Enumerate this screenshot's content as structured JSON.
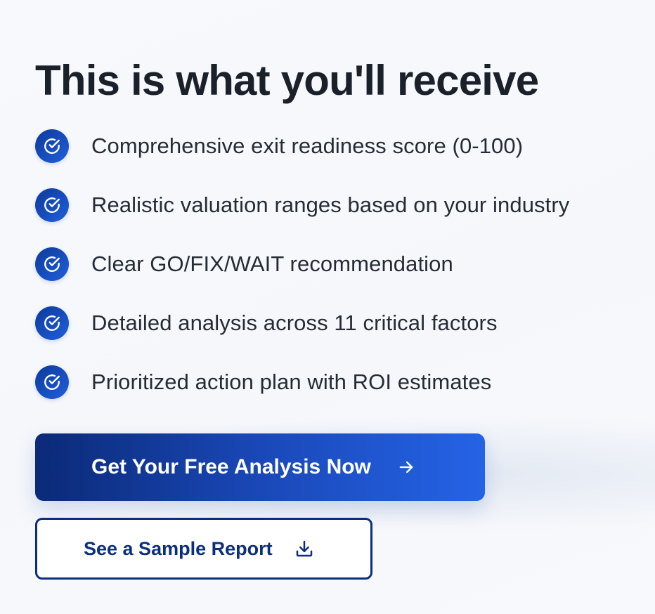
{
  "heading": "This is what you'll receive",
  "benefits": [
    {
      "icon": "check-circle-icon",
      "text": "Comprehensive exit readiness score (0-100)"
    },
    {
      "icon": "check-circle-icon",
      "text": "Realistic valuation ranges based on your industry"
    },
    {
      "icon": "check-circle-icon",
      "text": "Clear GO/FIX/WAIT recommendation"
    },
    {
      "icon": "check-circle-icon",
      "text": "Detailed analysis across 11 critical factors"
    },
    {
      "icon": "check-circle-icon",
      "text": "Prioritized action plan with ROI estimates"
    }
  ],
  "primary_cta": {
    "label": "Get Your Free Analysis Now",
    "icon": "arrow-right-icon"
  },
  "secondary_cta": {
    "label": "See a Sample Report",
    "icon": "download-icon"
  },
  "colors": {
    "heading": "#1b212b",
    "brand_dark": "#0b2a77",
    "brand_light": "#2563e6",
    "outline": "#0c2f7c"
  }
}
